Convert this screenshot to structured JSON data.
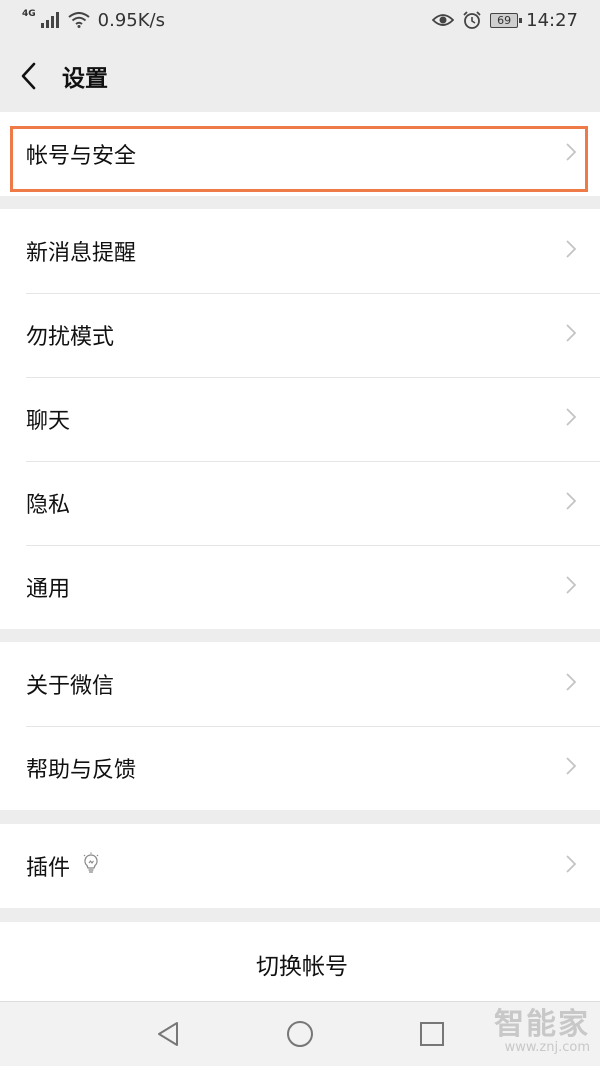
{
  "status_bar": {
    "network_gen": "4G",
    "speed": "0.95K/s",
    "battery": "69",
    "time": "14:27"
  },
  "header": {
    "title": "设置"
  },
  "groups": {
    "account": {
      "label": "帐号与安全"
    },
    "general": [
      {
        "label": "新消息提醒"
      },
      {
        "label": "勿扰模式"
      },
      {
        "label": "聊天"
      },
      {
        "label": "隐私"
      },
      {
        "label": "通用"
      }
    ],
    "about": [
      {
        "label": "关于微信"
      },
      {
        "label": "帮助与反馈"
      }
    ],
    "plugins": {
      "label": "插件",
      "icon": "lightbulb-icon"
    },
    "switch_account": {
      "label": "切换帐号"
    }
  },
  "highlight_color": "#ee7a48",
  "watermark": {
    "logo": "智能家",
    "url": "www.znj.com"
  }
}
